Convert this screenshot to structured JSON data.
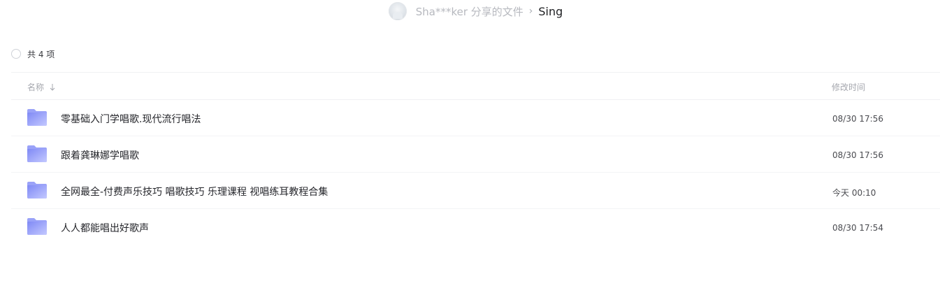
{
  "header": {
    "owner": "Sha***ker 分享的文件",
    "separator": "›",
    "current_folder": "Sing"
  },
  "toolbar": {
    "count_label": "共 4 项"
  },
  "columns": {
    "name": "名称",
    "modified": "修改时间"
  },
  "files": [
    {
      "name": "零基础入门学唱歌.现代流行唱法",
      "modified": "08/30 17:56",
      "icon": "folder-icon"
    },
    {
      "name": "跟着龚琳娜学唱歌",
      "modified": "08/30 17:56",
      "icon": "folder-icon"
    },
    {
      "name": "全网最全-付费声乐技巧 唱歌技巧 乐理课程 视唱练耳教程合集",
      "modified": "今天 00:10",
      "icon": "folder-icon"
    },
    {
      "name": "人人都能唱出好歌声",
      "modified": "08/30 17:54",
      "icon": "folder-icon"
    }
  ],
  "colors": {
    "folder_light": "#c4c9ff",
    "folder_dark": "#7f89f5",
    "muted_text": "#a5a7ae"
  }
}
